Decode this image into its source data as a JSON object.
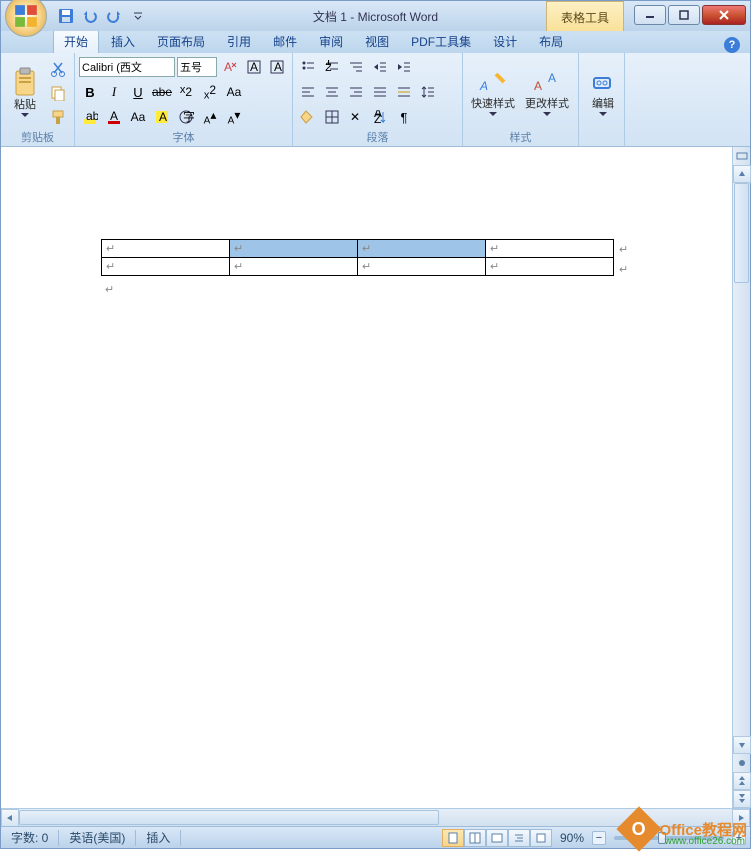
{
  "title": "文档 1 - Microsoft Word",
  "table_tools_label": "表格工具",
  "tabs": {
    "home": "开始",
    "insert": "插入",
    "layout": "页面布局",
    "ref": "引用",
    "mail": "邮件",
    "review": "审阅",
    "view": "视图",
    "pdf": "PDF工具集",
    "design": "设计",
    "tlayout": "布局"
  },
  "groups": {
    "clipboard": "剪贴板",
    "font": "字体",
    "paragraph": "段落",
    "styles": "样式",
    "editing": "编辑"
  },
  "clipboard": {
    "paste": "粘贴"
  },
  "font": {
    "name": "Calibri (西文",
    "size": "五号"
  },
  "styles": {
    "quick": "快速样式",
    "change": "更改样式"
  },
  "editing": {
    "label": "编辑"
  },
  "status": {
    "wordcount": "字数: 0",
    "language": "英语(美国)",
    "mode": "插入",
    "zoom": "90%"
  },
  "watermark": {
    "text": "Office教程网",
    "url": "www.office26.com"
  },
  "cellmark": "↵",
  "paramark": "↵"
}
